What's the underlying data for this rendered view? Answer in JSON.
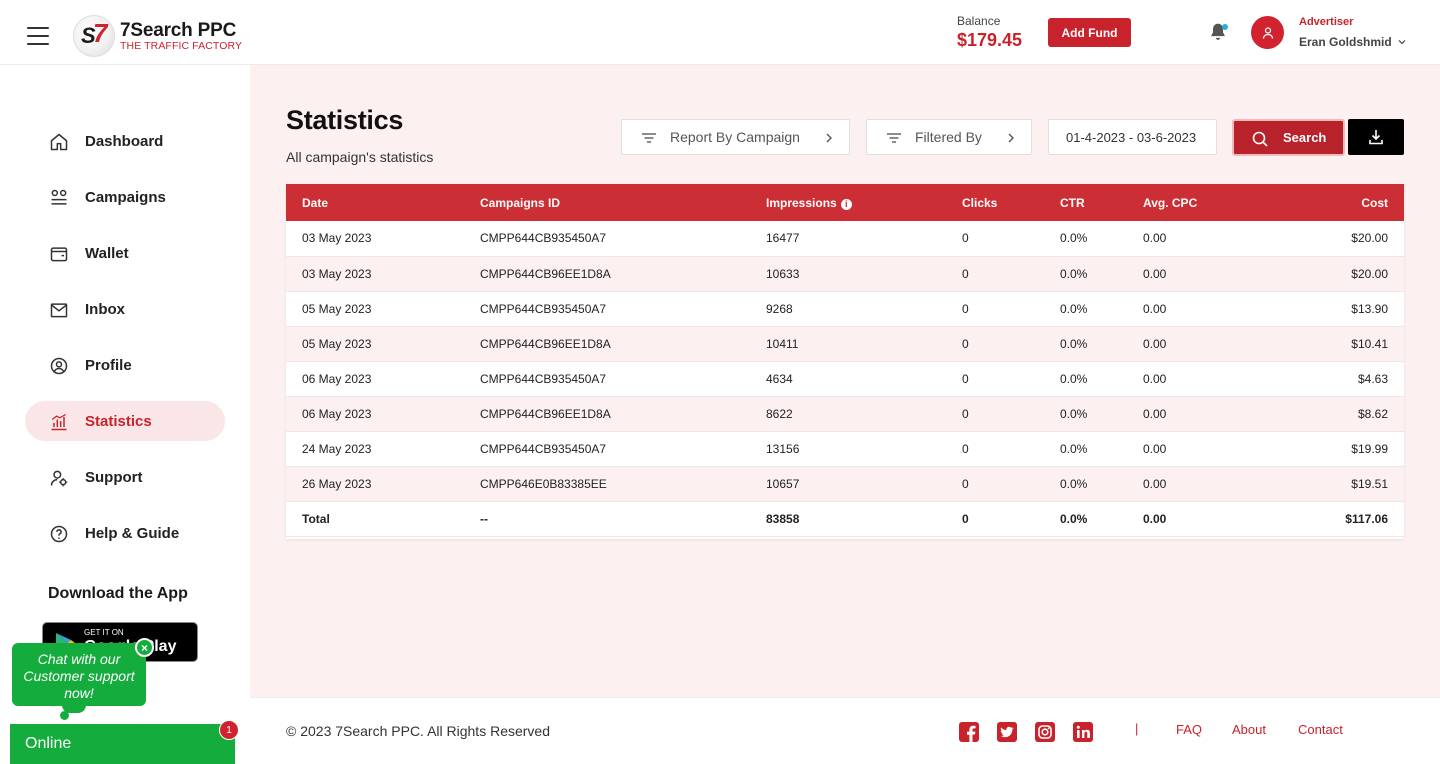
{
  "brand": {
    "name": "7Search PPC",
    "tagline": "THE TRAFFIC FACTORY"
  },
  "header": {
    "balance_label": "Balance",
    "balance_value": "$179.45",
    "add_fund_label": "Add Fund",
    "user_role": "Advertiser",
    "user_name": "Eran Goldshmid"
  },
  "sidebar": {
    "items": [
      {
        "label": "Dashboard",
        "icon": "home-icon"
      },
      {
        "label": "Campaigns",
        "icon": "campaigns-icon"
      },
      {
        "label": "Wallet",
        "icon": "wallet-icon"
      },
      {
        "label": "Inbox",
        "icon": "inbox-icon"
      },
      {
        "label": "Profile",
        "icon": "profile-icon"
      },
      {
        "label": "Statistics",
        "icon": "statistics-icon",
        "active": true
      },
      {
        "label": "Support",
        "icon": "support-icon"
      },
      {
        "label": "Help & Guide",
        "icon": "help-icon"
      }
    ],
    "download_title": "Download the App",
    "google_play_small": "GET IT ON",
    "google_play_big": "Google Play"
  },
  "chat": {
    "bubble_text": "Chat with our Customer support now!",
    "close_glyph": "×",
    "status": "Online",
    "badge_count": "1"
  },
  "main": {
    "title": "Statistics",
    "subtitle": "All campaign's statistics",
    "report_by_label": "Report By Campaign",
    "filtered_by_label": "Filtered By",
    "date_range": "01-4-2023 - 03-6-2023",
    "search_label": "Search"
  },
  "table": {
    "headers": [
      "Date",
      "Campaigns ID",
      "Impressions",
      "Clicks",
      "CTR",
      "Avg. CPC",
      "Cost"
    ],
    "rows": [
      [
        "03 May 2023",
        "CMPP644CB935450A7",
        "16477",
        "0",
        "0.0%",
        "0.00",
        "$20.00"
      ],
      [
        "03 May 2023",
        "CMPP644CB96EE1D8A",
        "10633",
        "0",
        "0.0%",
        "0.00",
        "$20.00"
      ],
      [
        "05 May 2023",
        "CMPP644CB935450A7",
        "9268",
        "0",
        "0.0%",
        "0.00",
        "$13.90"
      ],
      [
        "05 May 2023",
        "CMPP644CB96EE1D8A",
        "10411",
        "0",
        "0.0%",
        "0.00",
        "$10.41"
      ],
      [
        "06 May 2023",
        "CMPP644CB935450A7",
        "4634",
        "0",
        "0.0%",
        "0.00",
        "$4.63"
      ],
      [
        "06 May 2023",
        "CMPP644CB96EE1D8A",
        "8622",
        "0",
        "0.0%",
        "0.00",
        "$8.62"
      ],
      [
        "24 May 2023",
        "CMPP644CB935450A7",
        "13156",
        "0",
        "0.0%",
        "0.00",
        "$19.99"
      ],
      [
        "26 May 2023",
        "CMPP646E0B83385EE",
        "10657",
        "0",
        "0.0%",
        "0.00",
        "$19.51"
      ]
    ],
    "total": [
      "Total",
      "--",
      "83858",
      "0",
      "0.0%",
      "0.00",
      "$117.06"
    ]
  },
  "footer": {
    "copyright": "© 2023 7Search PPC. All Rights Reserved",
    "separator": "|",
    "links": [
      "FAQ",
      "About",
      "Contact"
    ],
    "social": [
      "facebook-icon",
      "twitter-icon",
      "instagram-icon",
      "linkedin-icon"
    ]
  },
  "colors": {
    "accent": "#c8232c",
    "page_bg": "#fcf0f1",
    "chat_green": "#14ad3d"
  }
}
